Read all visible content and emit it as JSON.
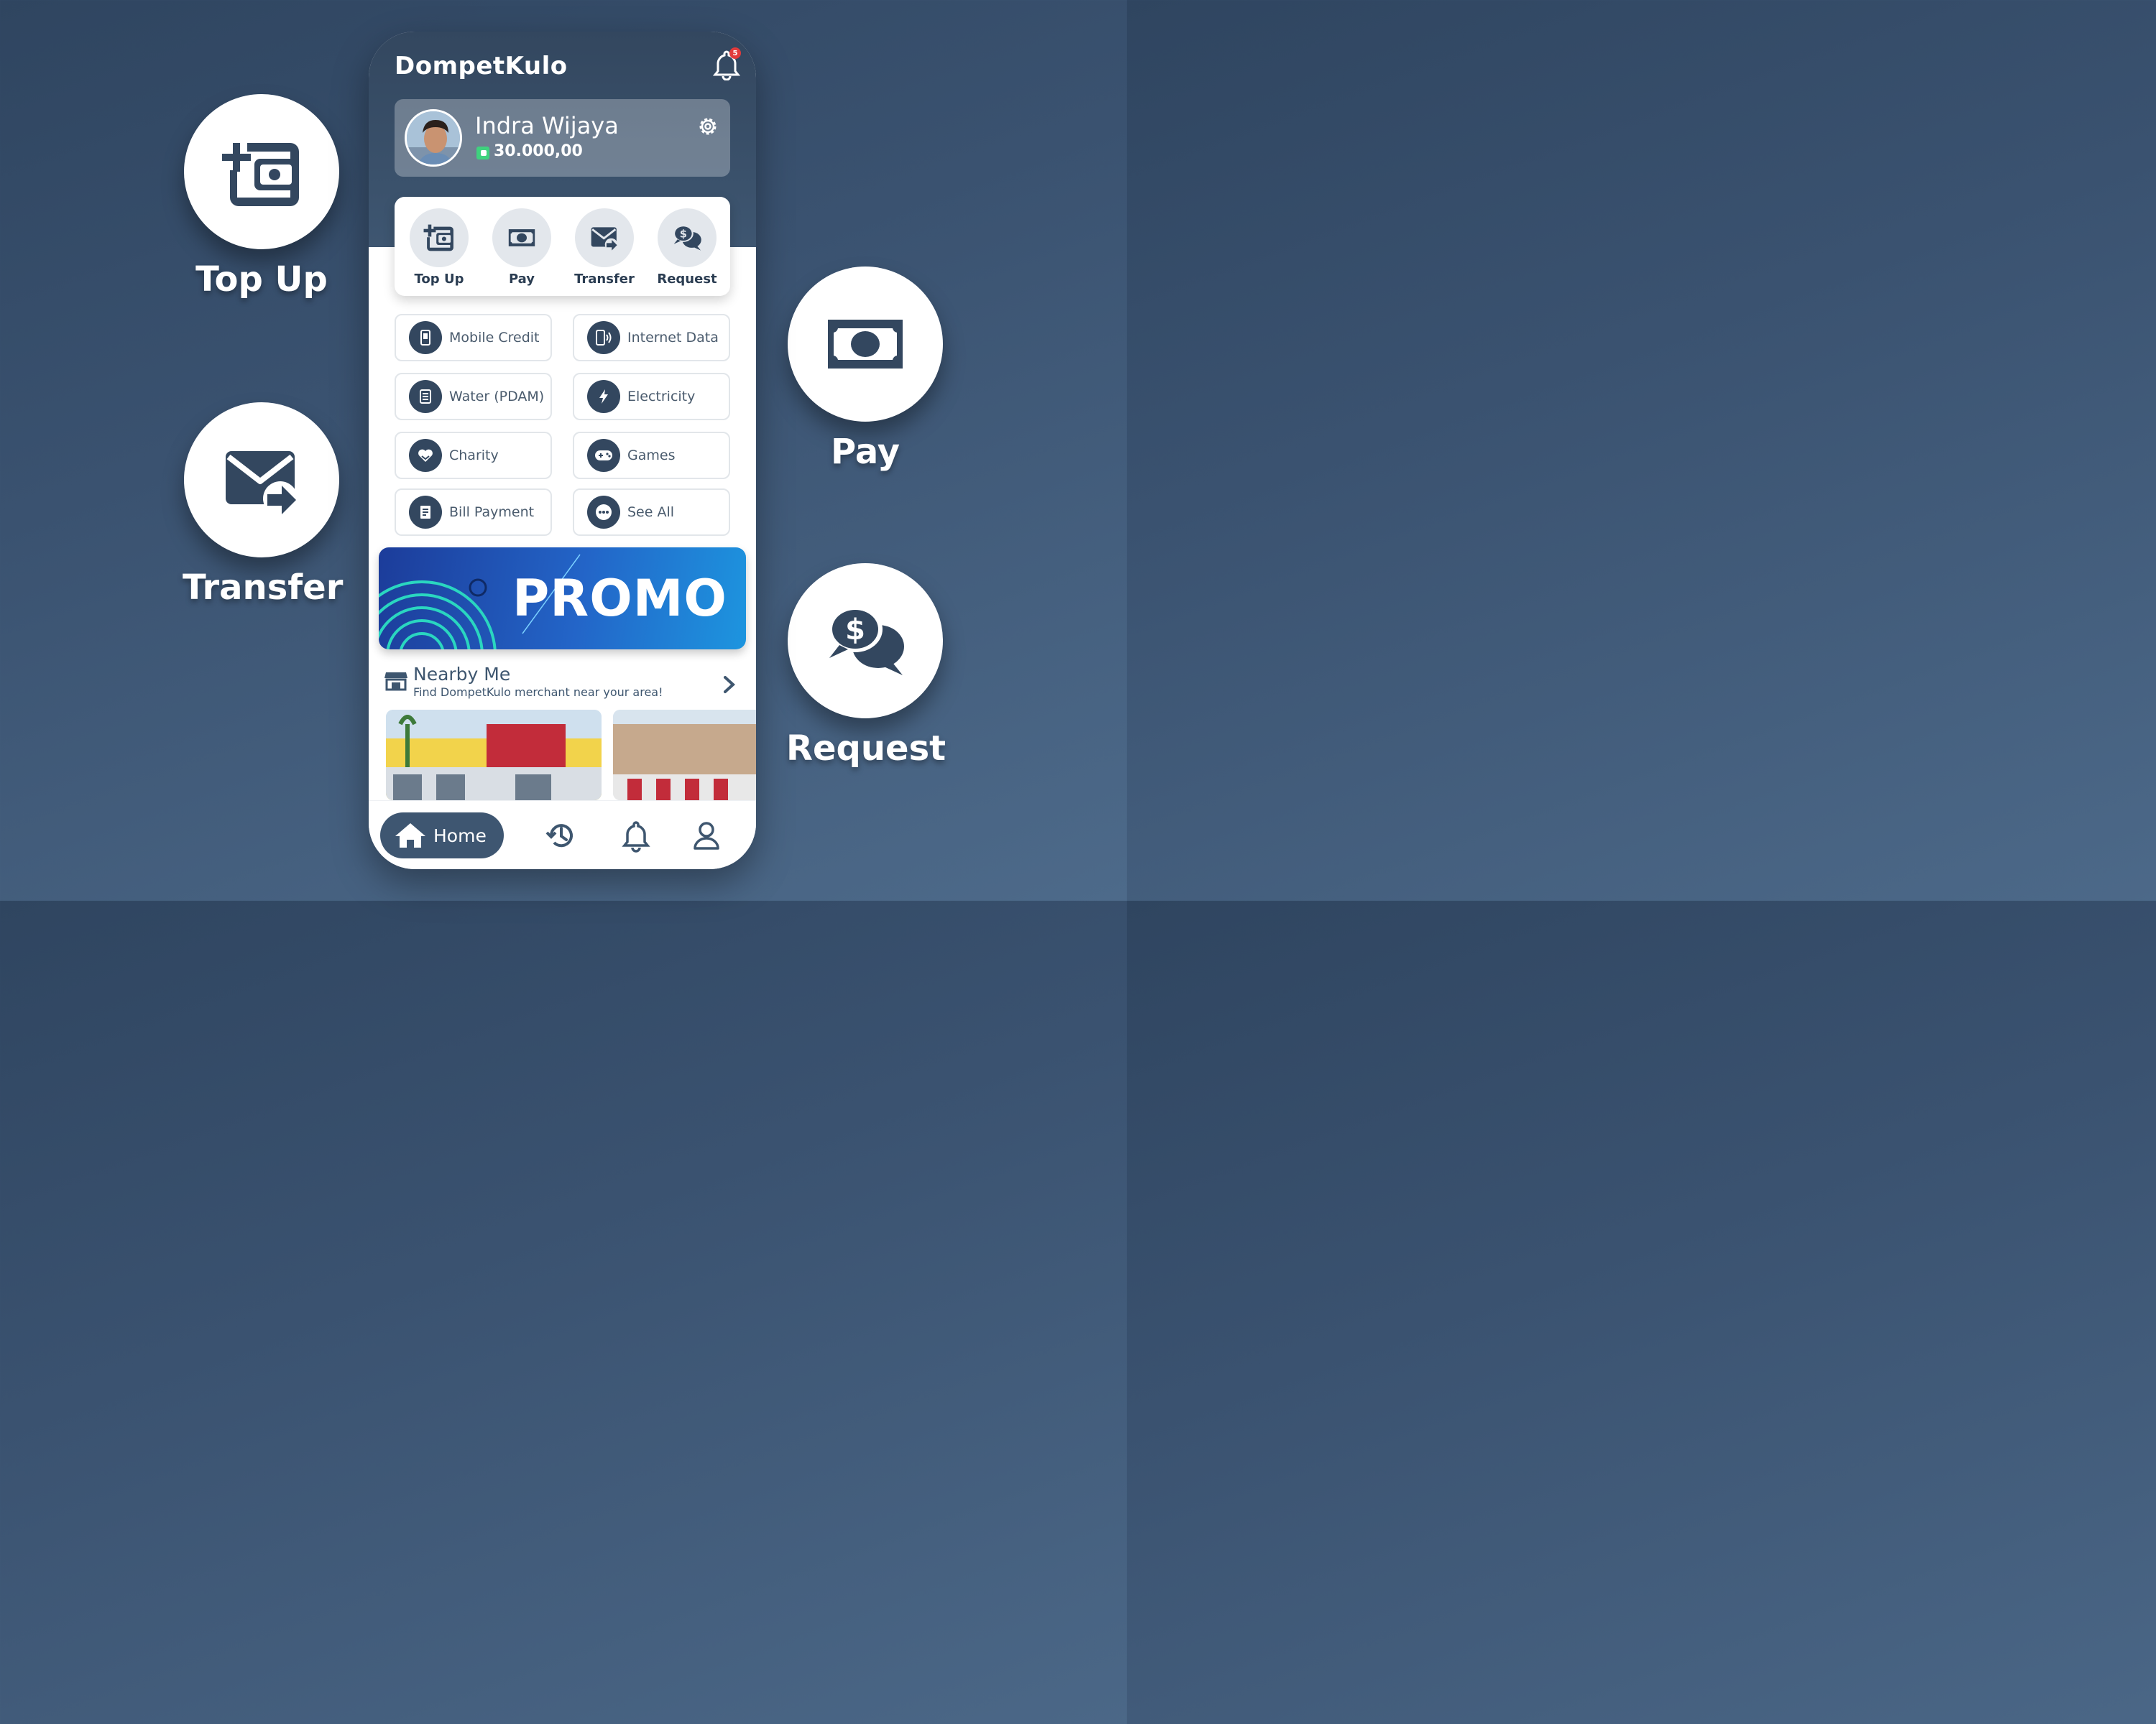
{
  "features": {
    "topup": "Top Up",
    "transfer": "Transfer",
    "pay": "Pay",
    "request": "Request"
  },
  "app": {
    "brand": "DompetKulo",
    "notification_count": "5"
  },
  "profile": {
    "name": "Indra Wijaya",
    "balance": "30.000,00"
  },
  "quick_actions": [
    {
      "label": "Top Up",
      "icon": "wallet-plus-icon"
    },
    {
      "label": "Pay",
      "icon": "banknote-icon"
    },
    {
      "label": "Transfer",
      "icon": "mail-send-icon"
    },
    {
      "label": "Request",
      "icon": "dollar-chat-icon"
    }
  ],
  "services": [
    {
      "label": "Mobile Credit",
      "icon": "phone-icon"
    },
    {
      "label": "Internet Data",
      "icon": "signal-phone-icon"
    },
    {
      "label": "Water (PDAM)",
      "icon": "water-icon"
    },
    {
      "label": "Electricity",
      "icon": "bolt-icon"
    },
    {
      "label": "Charity",
      "icon": "heart-hand-icon"
    },
    {
      "label": "Games",
      "icon": "gamepad-icon"
    },
    {
      "label": "Bill Payment",
      "icon": "bill-icon"
    },
    {
      "label": "See All",
      "icon": "more-icon"
    }
  ],
  "promo": {
    "text": "PROMO"
  },
  "nearby": {
    "title": "Nearby Me",
    "subtitle": "Find DompetKulo merchant near your area!"
  },
  "nav": {
    "home": "Home"
  },
  "colors": {
    "primary": "#33475f",
    "accent_green": "#3fd27e",
    "badge_red": "#e23b3b",
    "promo_blue": "#2365c8"
  }
}
